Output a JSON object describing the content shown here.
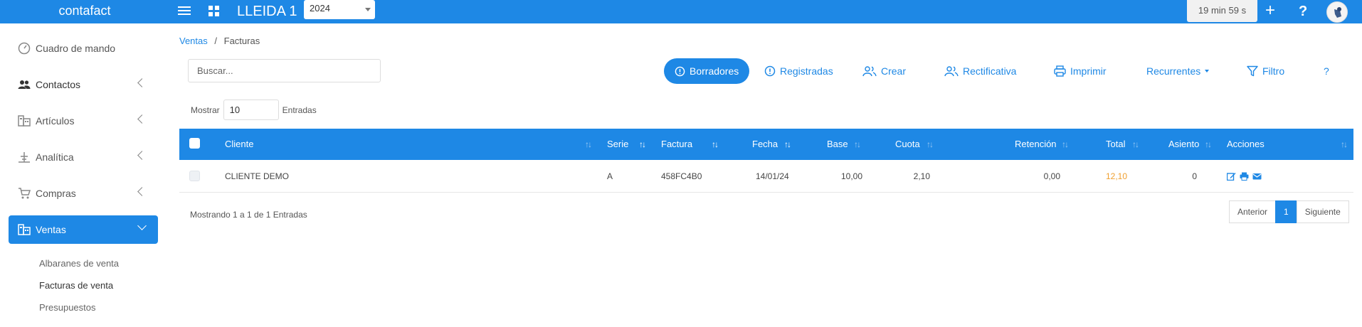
{
  "topbar": {
    "brand": "contafact",
    "company": "LLEIDA 1",
    "year": "2024",
    "timer": "19 min 59 s",
    "add_label": "+",
    "help_label": "?"
  },
  "sidebar": {
    "items": [
      {
        "label": "Cuadro de mando",
        "icon": "dashboard-icon"
      },
      {
        "label": "Contactos",
        "icon": "users-icon"
      },
      {
        "label": "Artículos",
        "icon": "articles-icon"
      },
      {
        "label": "Analítica",
        "icon": "analytics-icon"
      },
      {
        "label": "Compras",
        "icon": "cart-icon"
      },
      {
        "label": "Ventas",
        "icon": "sales-icon"
      }
    ],
    "sub_items": [
      "Albaranes de venta",
      "Facturas de venta",
      "Presupuestos"
    ]
  },
  "breadcrumb": {
    "parent": "Ventas",
    "separator": "/",
    "current": "Facturas"
  },
  "search": {
    "placeholder": "Buscar..."
  },
  "toolbar": {
    "borradores": "Borradores",
    "registradas": "Registradas",
    "crear": "Crear",
    "rectificativa": "Rectificativa",
    "imprimir": "Imprimir",
    "recurrentes": "Recurrentes",
    "filtro": "Filtro",
    "help": "?"
  },
  "entries": {
    "show_label": "Mostrar",
    "value": "10",
    "entries_label": "Entradas"
  },
  "table": {
    "columns": [
      "Cliente",
      "Serie",
      "Factura",
      "Fecha",
      "Base",
      "Cuota",
      "Retención",
      "Total",
      "Asiento",
      "Acciones"
    ],
    "rows": [
      {
        "cliente": "CLIENTE DEMO",
        "serie": "A",
        "factura": "458FC4B0",
        "fecha": "14/01/24",
        "base": "10,00",
        "cuota": "2,10",
        "retencion": "0,00",
        "total": "12,10",
        "asiento": "0"
      }
    ]
  },
  "footer": {
    "info": "Mostrando 1 a 1 de 1 Entradas"
  },
  "pagination": {
    "prev": "Anterior",
    "current": "1",
    "next": "Siguiente"
  },
  "colors": {
    "accent": "#1e88e5",
    "total": "#f0a030"
  }
}
